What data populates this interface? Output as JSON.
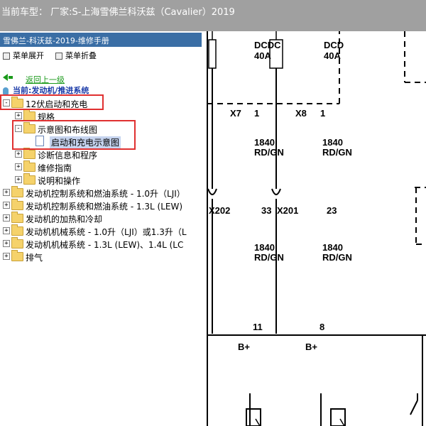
{
  "window": {
    "title": "当前车型： 厂家:S-上海雪佛兰科沃兹（Cavalier）2019"
  },
  "manual": {
    "header": "雪佛兰-科沃兹-2019-维修手册",
    "expand_label": "菜单展开",
    "collapse_label": "菜单折叠",
    "back_label": "返回上一级",
    "current_label": "当前:发动机/推进系统"
  },
  "tree": [
    {
      "label": "12伏启动和充电",
      "level": 0,
      "toggle": "-",
      "icon": "folder",
      "highlighted": true
    },
    {
      "label": "规格",
      "level": 1,
      "toggle": "+",
      "icon": "folder"
    },
    {
      "label": "示意图和布线图",
      "level": 1,
      "toggle": "-",
      "icon": "folder",
      "highlighted": true
    },
    {
      "label": "启动和充电示意图",
      "level": 2,
      "toggle": "",
      "icon": "document",
      "selected": true,
      "highlighted": true
    },
    {
      "label": "诊断信息和程序",
      "level": 1,
      "toggle": "+",
      "icon": "folder"
    },
    {
      "label": "维修指南",
      "level": 1,
      "toggle": "+",
      "icon": "folder"
    },
    {
      "label": "说明和操作",
      "level": 1,
      "toggle": "+",
      "icon": "folder"
    },
    {
      "label": "发动机控制系统和燃油系统 - 1.0升（LJI）",
      "level": 0,
      "toggle": "+",
      "icon": "folder"
    },
    {
      "label": "发动机控制系统和燃油系统 - 1.3L (LEW)",
      "level": 0,
      "toggle": "+",
      "icon": "folder"
    },
    {
      "label": "发动机的加热和冷却",
      "level": 0,
      "toggle": "+",
      "icon": "folder"
    },
    {
      "label": "发动机机械系统 - 1.0升（LJI）或1.3升（L",
      "level": 0,
      "toggle": "+",
      "icon": "folder"
    },
    {
      "label": "发动机机械系统 - 1.3L (LEW)、1.4L (LC",
      "level": 0,
      "toggle": "+",
      "icon": "folder"
    },
    {
      "label": "排气",
      "level": 0,
      "toggle": "+",
      "icon": "folder"
    }
  ],
  "diagram": {
    "fuse1_label": "DCDC",
    "fuse1_amp": "40A",
    "fuse2_label": "DCD",
    "fuse2_amp": "40A",
    "conn_x7": "X7",
    "conn_x7_pin": "1",
    "conn_x8": "X8",
    "conn_x8_pin": "1",
    "wire1_size": "1840",
    "wire1_color": "RD/GN",
    "wire2_size": "1840",
    "wire2_color": "RD/GN",
    "conn_x202": "X202",
    "conn_x202_pin": "33",
    "conn_x201": "X201",
    "conn_x201_pin": "23",
    "wire3_size": "1840",
    "wire3_color": "RD/GN",
    "wire4_size": "1840",
    "wire4_color": "RD/GN",
    "pin_11": "11",
    "pin_8": "8",
    "bplus_1": "B+",
    "bplus_2": "B+"
  }
}
